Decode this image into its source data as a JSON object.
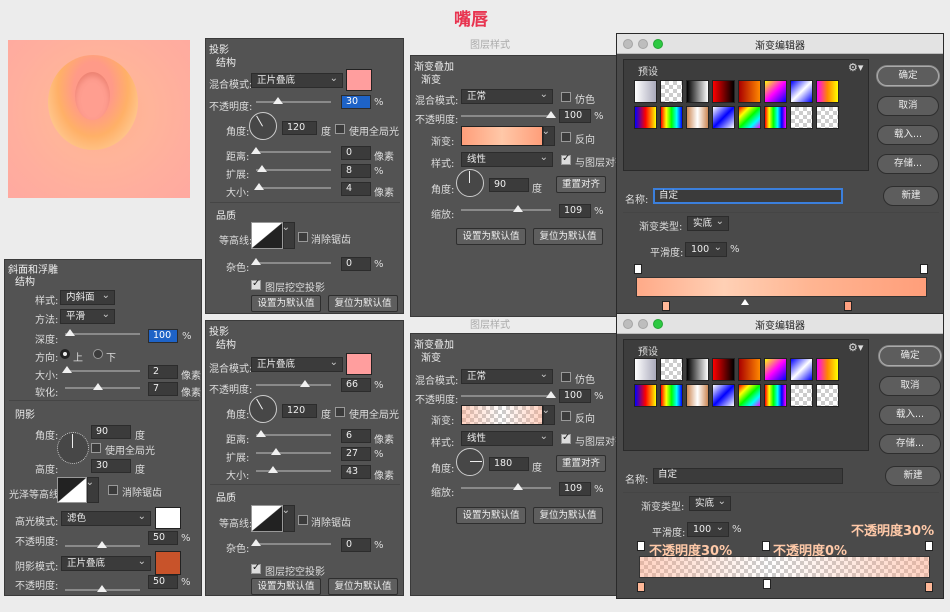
{
  "title": "嘴唇",
  "colors": {
    "title": "#e8334f",
    "swatch_pink": "#ff9e9e",
    "swatch_white": "#ffffff",
    "swatch_orange": "#c8532a",
    "gradient_peach": "#ff9e7a"
  },
  "bevel": {
    "title": "斜面和浮雕",
    "section": "结构",
    "style_label": "样式:",
    "style_value": "内斜面",
    "method_label": "方法:",
    "method_value": "平滑",
    "depth_label": "深度:",
    "depth_value": "100",
    "depth_unit": "%",
    "direction_label": "方向:",
    "dir_up": "上",
    "dir_down": "下",
    "size_label": "大小:",
    "size_value": "2",
    "size_unit": "像素",
    "soften_label": "软化:",
    "soften_value": "7",
    "soften_unit": "像素",
    "shading_title": "阴影",
    "angle_label": "角度:",
    "angle_value": "90",
    "angle_unit": "度",
    "global_light": "使用全局光",
    "altitude_label": "高度:",
    "altitude_value": "30",
    "altitude_unit": "度",
    "gloss_label": "光泽等高线:",
    "antialias": "消除锯齿",
    "highlight_label": "高光模式:",
    "highlight_value": "滤色",
    "opacity_label": "不透明度:",
    "hl_opacity": "50",
    "opacity_unit": "%",
    "shadow_label": "阴影模式:",
    "shadow_value": "正片叠底",
    "sh_opacity": "50"
  },
  "drop_shadows": [
    {
      "title": "投影",
      "section": "结构",
      "blend_label": "混合模式:",
      "blend_value": "正片叠底",
      "opacity_label": "不透明度:",
      "opacity_value": "30",
      "pct": "%",
      "angle_label": "角度:",
      "angle_value": "120",
      "angle_unit": "度",
      "global_light": "使用全局光",
      "distance_label": "距离:",
      "distance_value": "0",
      "px": "像素",
      "spread_label": "扩展:",
      "spread_value": "8",
      "size_label": "大小:",
      "size_value": "4",
      "quality_title": "品质",
      "contour_label": "等高线:",
      "antialias": "消除锯齿",
      "noise_label": "杂色:",
      "noise_value": "0",
      "knockout": "图层挖空投影",
      "btn_default": "设置为默认值",
      "btn_reset": "复位为默认值"
    },
    {
      "title": "投影",
      "section": "结构",
      "blend_label": "混合模式:",
      "blend_value": "正片叠底",
      "opacity_label": "不透明度:",
      "opacity_value": "66",
      "pct": "%",
      "angle_label": "角度:",
      "angle_value": "120",
      "angle_unit": "度",
      "global_light": "使用全局光",
      "distance_label": "距离:",
      "distance_value": "6",
      "px": "像素",
      "spread_label": "扩展:",
      "spread_value": "27",
      "size_label": "大小:",
      "size_value": "43",
      "quality_title": "品质",
      "contour_label": "等高线:",
      "antialias": "消除锯齿",
      "noise_label": "杂色:",
      "noise_value": "0",
      "knockout": "图层挖空投影",
      "btn_default": "设置为默认值",
      "btn_reset": "复位为默认值"
    }
  ],
  "gradient_overlays": [
    {
      "caption": "图层样式",
      "title": "渐变叠加",
      "section": "渐变",
      "blend_label": "混合模式:",
      "blend_value": "正常",
      "dither": "仿色",
      "opacity_label": "不透明度:",
      "opacity_value": "100",
      "pct": "%",
      "gradient_label": "渐变:",
      "reverse": "反向",
      "style_label": "样式:",
      "style_value": "线性",
      "align": "与图层对齐",
      "angle_label": "角度:",
      "angle_value": "90",
      "angle_unit": "度",
      "reset_align": "重置对齐",
      "scale_label": "缩放:",
      "scale_value": "109",
      "btn_default": "设置为默认值",
      "btn_reset": "复位为默认值"
    },
    {
      "caption": "图层样式",
      "title": "渐变叠加",
      "section": "渐变",
      "blend_label": "混合模式:",
      "blend_value": "正常",
      "dither": "仿色",
      "opacity_label": "不透明度:",
      "opacity_value": "100",
      "pct": "%",
      "gradient_label": "渐变:",
      "reverse": "反向",
      "style_label": "样式:",
      "style_value": "线性",
      "align": "与图层对齐",
      "angle_label": "角度:",
      "angle_value": "180",
      "angle_unit": "度",
      "reset_align": "重置对齐",
      "scale_label": "缩放:",
      "scale_value": "109",
      "btn_default": "设置为默认值",
      "btn_reset": "复位为默认值"
    }
  ],
  "editors": [
    {
      "title": "渐变编辑器",
      "presets": "预设",
      "ok": "确定",
      "cancel": "取消",
      "load": "载入...",
      "save": "存储...",
      "name_label": "名称:",
      "name_value": "自定",
      "new": "新建",
      "type_label": "渐变类型:",
      "type_value": "实底",
      "smooth_label": "平滑度:",
      "smooth_value": "100",
      "pct": "%"
    },
    {
      "title": "渐变编辑器",
      "presets": "预设",
      "ok": "确定",
      "cancel": "取消",
      "load": "载入...",
      "save": "存储...",
      "name_label": "名称:",
      "name_value": "自定",
      "new": "新建",
      "type_label": "渐变类型:",
      "type_value": "实底",
      "smooth_label": "平滑度:",
      "smooth_value": "100",
      "pct": "%",
      "annot_right": "不透明度30%",
      "annot_left": "不透明度30%",
      "annot_mid": "不透明度0%"
    }
  ]
}
